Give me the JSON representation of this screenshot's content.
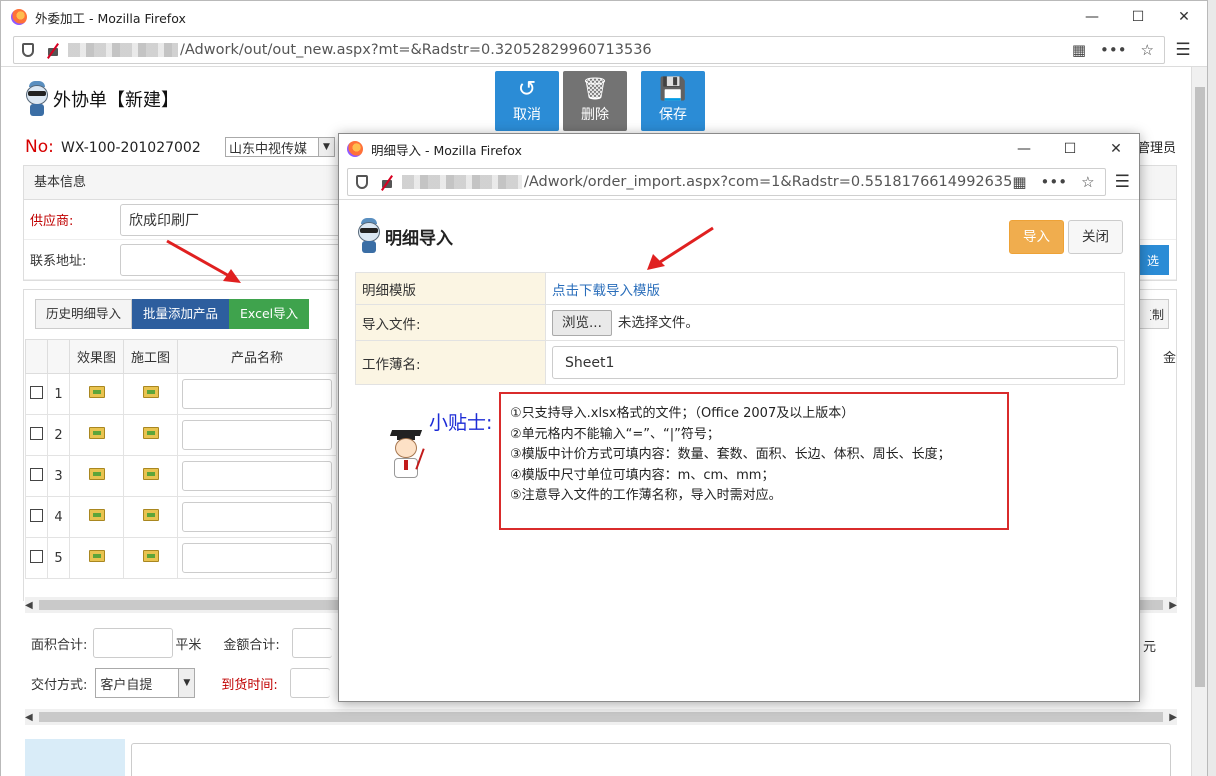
{
  "outer": {
    "window_title": "外委加工 - Mozilla Firefox",
    "url_path": "/Adwork/out/out_new.aspx?mt=&Radstr=0.32052829960713536",
    "page_title": "外协单【新建】",
    "toolbar": {
      "cancel": "取消",
      "delete": "删除",
      "save": "保存"
    },
    "no_label": "No:",
    "no_value": "WX-100-201027002",
    "company": "山东中视传媒",
    "admin": "管理员",
    "basic_info": "基本信息",
    "supplier_label": "供应商:",
    "supplier_value": "欣成印刷厂",
    "address_label": "联系地址:",
    "grid_buttons": {
      "history": "历史明细导入",
      "batch_add": "批量添加产品",
      "excel": "Excel导入"
    },
    "grid_headers": {
      "effect": "效果图",
      "work": "施工图",
      "product_name": "产品名称",
      "amount_col": "金"
    },
    "rows": [
      "1",
      "2",
      "3",
      "4",
      "5"
    ],
    "area_label": "面积合计:",
    "area_unit": "平米",
    "amount_label": "金额合计:",
    "amount_unit": "元",
    "delivery_label": "交付方式:",
    "delivery_value": "客户自提",
    "arrival_label": "到货时间:",
    "select_btn": "选",
    "copy_btn": "复制"
  },
  "popup": {
    "window_title": "明细导入 - Mozilla Firefox",
    "url_path": "/Adwork/order_import.aspx?com=1&Radstr=0.5518176614992635",
    "title": "明细导入",
    "import_btn": "导入",
    "close_btn": "关闭",
    "template_label": "明细模版",
    "template_link": "点击下载导入模版",
    "file_label": "导入文件:",
    "browse_btn": "浏览...",
    "file_status": "未选择文件。",
    "sheet_label": "工作薄名:",
    "sheet_value": "Sheet1",
    "tips_label": "小贴士:",
    "tips": [
      "①只支持导入.xlsx格式的文件；（Office 2007及以上版本）",
      "②单元格内不能输入“=”、“|”符号；",
      "③模版中计价方式可填内容：数量、套数、面积、长边、体积、周长、长度；",
      "④模版中尺寸单位可填内容：m、cm、mm；",
      "⑤注意导入文件的工作薄名称，导入时需对应。"
    ]
  },
  "colors": {
    "accent_blue": "#2b8cd6",
    "tips_border": "#d92b2b",
    "import_orange": "#f0ad4e",
    "excel_green": "#3fa34d"
  }
}
